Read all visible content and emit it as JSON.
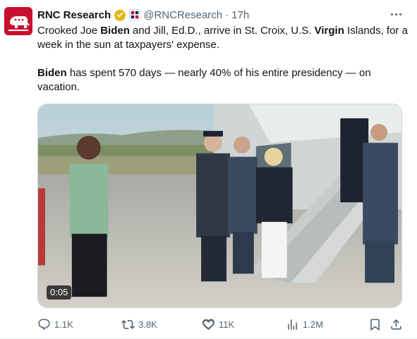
{
  "tweet": {
    "author_name": "RNC Research",
    "handle": "@RNCResearch",
    "separator": "·",
    "time": "17h",
    "paragraph1": [
      {
        "text": "Crooked Joe ",
        "bold": false
      },
      {
        "text": "Biden",
        "bold": true
      },
      {
        "text": " and Jill, Ed.D., arrive in St. Croix, U.S. ",
        "bold": false
      },
      {
        "text": "Virgin",
        "bold": true
      },
      {
        "text": " Islands, for a week in the sun at taxpayers' expense.",
        "bold": false
      }
    ],
    "paragraph2": [
      {
        "text": "Biden",
        "bold": true
      },
      {
        "text": " has spent 570 days — nearly 40% of his entire presidency — on vacation.",
        "bold": false
      }
    ]
  },
  "media": {
    "duration": "0:05"
  },
  "actions": {
    "replies": "1.1K",
    "reposts": "3.8K",
    "likes": "11K",
    "views": "1.2M"
  },
  "icons": {
    "reply": "reply-icon",
    "repost": "repost-icon",
    "like": "heart-icon",
    "views": "views-icon",
    "bookmark": "bookmark-icon",
    "share": "share-icon",
    "verified": "gold-verified-badge-icon",
    "more": "more-options-icon"
  },
  "colors": {
    "brand_red": "#c8102e",
    "verified_gold": "#e2b719",
    "secondary_text": "#536471"
  }
}
